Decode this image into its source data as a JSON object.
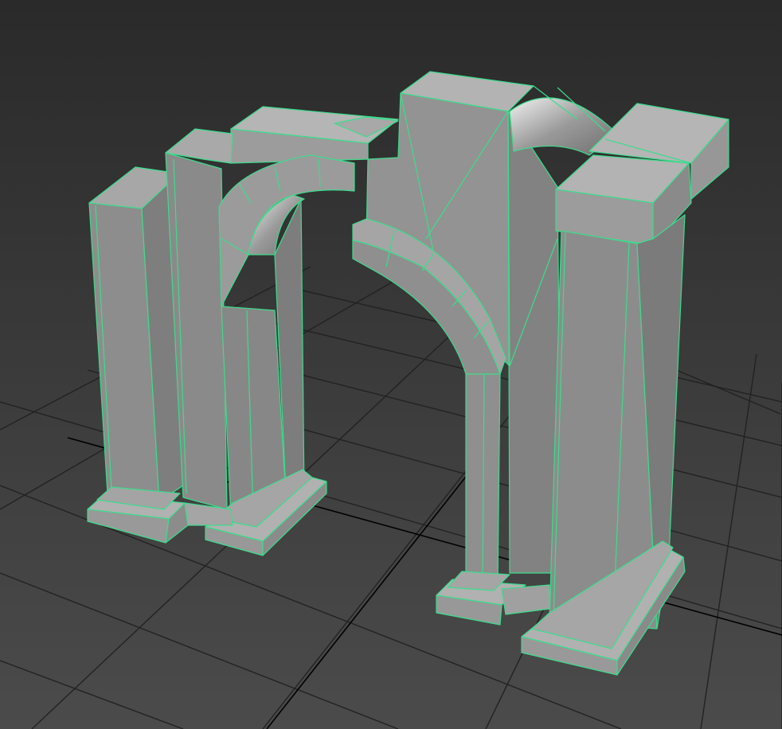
{
  "viewport": {
    "background_top": "#2b2b2b",
    "background_bottom": "#4a4a4a",
    "grid_color": "#222222",
    "wire_color": "#3ddc8c",
    "face_light": "#a9a9a9",
    "face_mid": "#8f8f8f",
    "face_dark": "#777777"
  },
  "scene": {
    "object": "arch-gate-model",
    "mode": "perspective-shaded-with-edges"
  }
}
